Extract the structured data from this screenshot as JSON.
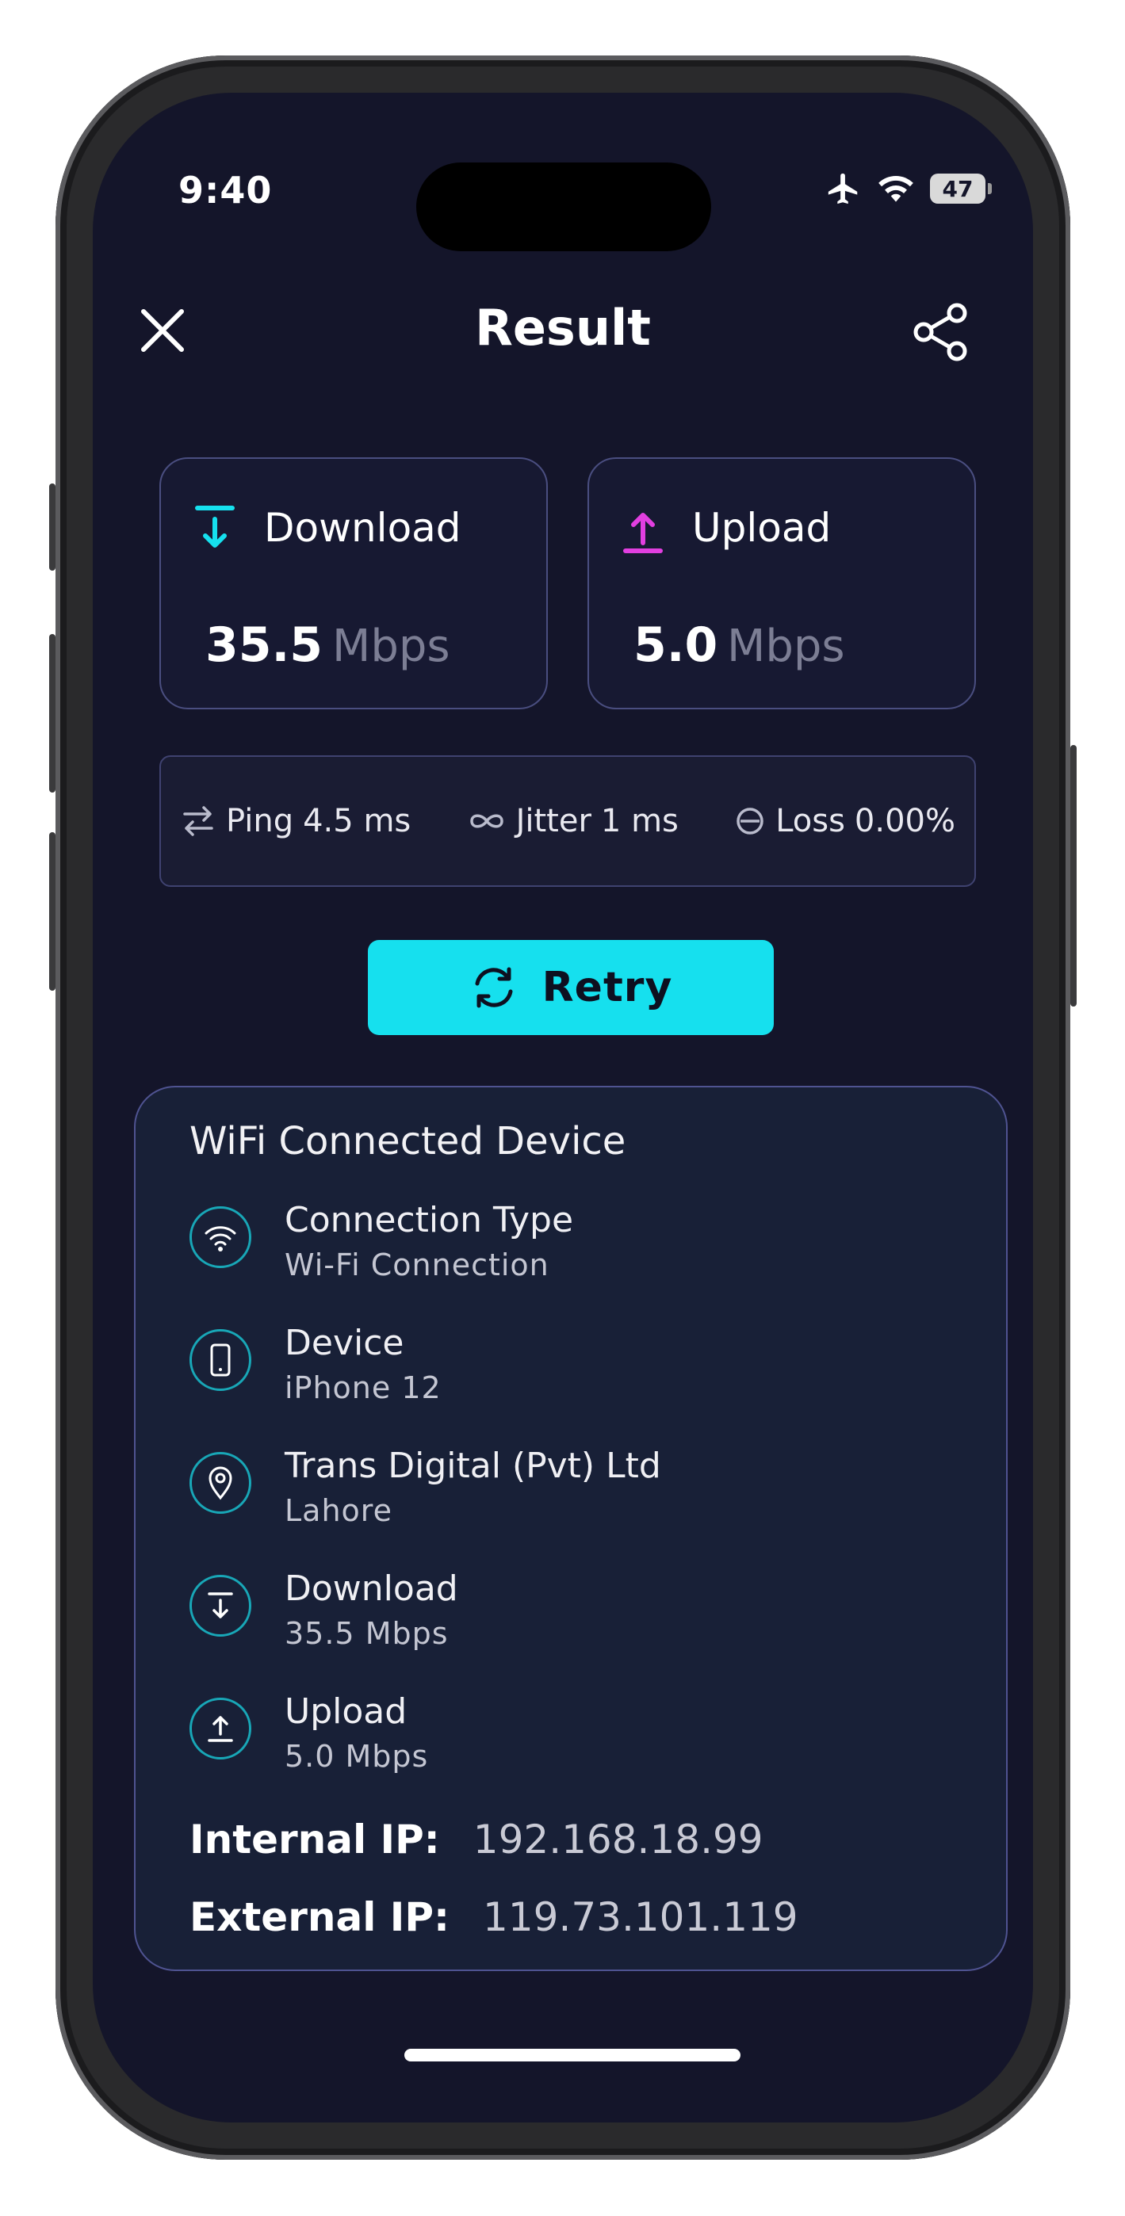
{
  "status": {
    "time": "9:40",
    "battery": "47"
  },
  "header": {
    "title": "Result"
  },
  "download_card": {
    "label": "Download",
    "value": "35.5",
    "unit": "Mbps"
  },
  "upload_card": {
    "label": "Upload",
    "value": "5.0",
    "unit": "Mbps"
  },
  "metrics": {
    "ping": {
      "label": "Ping",
      "value": "4.5 ms"
    },
    "jitter": {
      "label": "Jitter",
      "value": "1 ms"
    },
    "loss": {
      "label": "Loss",
      "value": "0.00%"
    }
  },
  "retry_label": "Retry",
  "info": {
    "title": "WiFi Connected Device",
    "rows": [
      {
        "title": "Connection Type",
        "subtitle": "Wi-Fi Connection",
        "icon": "wifi-icon"
      },
      {
        "title": "Device",
        "subtitle": "iPhone 12",
        "icon": "phone-icon"
      },
      {
        "title": "Trans Digital (Pvt) Ltd",
        "subtitle": "Lahore",
        "icon": "location-icon"
      },
      {
        "title": "Download",
        "subtitle": "35.5 Mbps",
        "icon": "download-icon"
      },
      {
        "title": "Upload",
        "subtitle": "5.0 Mbps",
        "icon": "upload-icon"
      }
    ],
    "internal_ip": {
      "label": "Internal IP:",
      "value": "192.168.18.99"
    },
    "external_ip": {
      "label": "External IP:",
      "value": "119.73.101.119"
    }
  },
  "colors": {
    "accent": "#16e0ee",
    "upload": "#e23fe0",
    "background": "#14152a"
  }
}
